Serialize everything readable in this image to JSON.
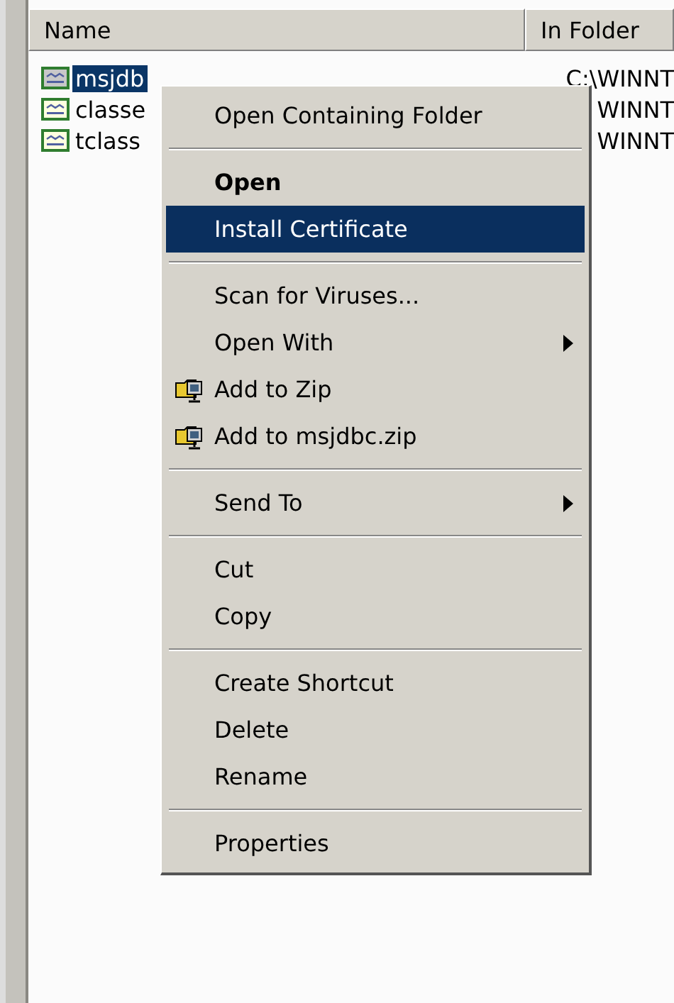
{
  "columns": [
    "Name",
    "In Folder"
  ],
  "files": [
    {
      "name": "msjdb",
      "folder": "C:\\WINNT",
      "selected": true
    },
    {
      "name": "classe",
      "folder": "WINNT",
      "selected": false
    },
    {
      "name": "tclass",
      "folder": "WINNT",
      "selected": false
    }
  ],
  "context_menu": [
    {
      "kind": "item",
      "label": "Open Containing Folder",
      "bold": false,
      "selected": false
    },
    {
      "kind": "separator"
    },
    {
      "kind": "item",
      "label": "Open",
      "bold": true,
      "selected": false
    },
    {
      "kind": "item",
      "label": "Install Certificate",
      "bold": false,
      "selected": true
    },
    {
      "kind": "separator"
    },
    {
      "kind": "item",
      "label": "Scan for Viruses...",
      "bold": false,
      "selected": false
    },
    {
      "kind": "submenu",
      "label": "Open With",
      "bold": false,
      "selected": false
    },
    {
      "kind": "zip",
      "label": "Add to Zip",
      "bold": false,
      "selected": false
    },
    {
      "kind": "zip",
      "label": "Add to msjdbc.zip",
      "bold": false,
      "selected": false
    },
    {
      "kind": "separator"
    },
    {
      "kind": "submenu",
      "label": "Send To",
      "bold": false,
      "selected": false
    },
    {
      "kind": "separator"
    },
    {
      "kind": "item",
      "label": "Cut",
      "bold": false,
      "selected": false
    },
    {
      "kind": "item",
      "label": "Copy",
      "bold": false,
      "selected": false
    },
    {
      "kind": "separator"
    },
    {
      "kind": "item",
      "label": "Create Shortcut",
      "bold": false,
      "selected": false
    },
    {
      "kind": "item",
      "label": "Delete",
      "bold": false,
      "selected": false
    },
    {
      "kind": "item",
      "label": "Rename",
      "bold": false,
      "selected": false
    },
    {
      "kind": "separator"
    },
    {
      "kind": "item",
      "label": "Properties",
      "bold": false,
      "selected": false
    }
  ]
}
